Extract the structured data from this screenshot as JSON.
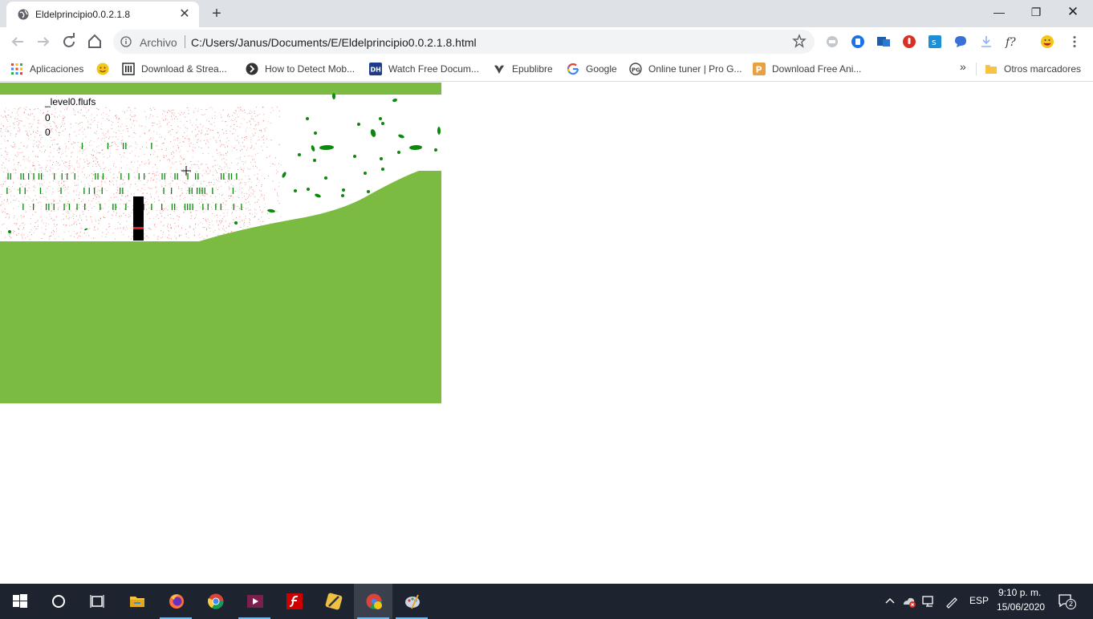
{
  "tab": {
    "title": "Eldelprincipio0.0.2.1.8",
    "close": "✕"
  },
  "new_tab": "+",
  "window": {
    "minimize": "—",
    "maximize": "❐",
    "close": "✕"
  },
  "omnibox": {
    "scheme_label": "Archivo",
    "url": "C:/Users/Janus/Documents/E/Eldelprincipio0.0.2.1.8.html"
  },
  "bookmarks": {
    "items": [
      {
        "label": "Aplicaciones",
        "icon": "apps-grid-icon"
      },
      {
        "label": "",
        "icon": "emoji-icon"
      },
      {
        "label": "Download & Strea...",
        "icon": "archive-icon"
      },
      {
        "label": "How to Detect Mob...",
        "icon": "site-icon"
      },
      {
        "label": "Watch Free Docum...",
        "icon": "dh-icon"
      },
      {
        "label": "Epublibre",
        "icon": "epublibre-icon"
      },
      {
        "label": "Google",
        "icon": "google-icon"
      },
      {
        "label": "Online tuner | Pro G...",
        "icon": "tuner-icon"
      },
      {
        "label": "Download Free Ani...",
        "icon": "p-icon"
      }
    ],
    "overflow": "»",
    "other": "Otros marcadores"
  },
  "game": {
    "hud_variable": "_level0.flufs",
    "hud_value_a": "0",
    "hud_value_b": "0",
    "colors": {
      "grass": "#7cbb42",
      "leaf": "#0a8a0a",
      "particle": "#e06060",
      "player": "#000000"
    }
  },
  "taskbar": {
    "time": "9:10 p. m.",
    "date": "15/06/2020",
    "language": "ESP",
    "notifications": "2"
  }
}
